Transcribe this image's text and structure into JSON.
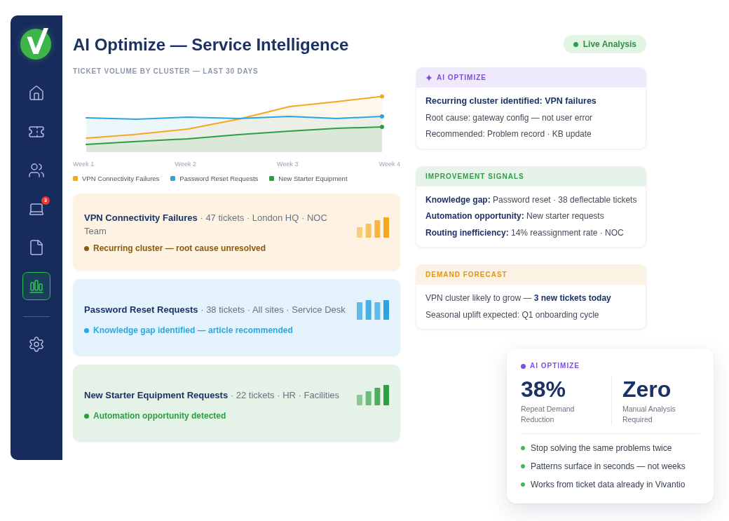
{
  "sidebar": {
    "nav_items": [
      {
        "selected": false
      },
      {
        "selected": false
      },
      {
        "selected": false
      },
      {
        "selected": false,
        "badge": "3"
      },
      {
        "selected": false
      },
      {
        "selected": true
      }
    ],
    "bottom_items": [
      {
        "selected": false
      }
    ]
  },
  "title": "AI Optimize — Service Intelligence",
  "status_pill": {
    "label": "Live Analysis"
  },
  "chart": {
    "title": "TICKET VOLUME BY CLUSTER — LAST 30 DAYS",
    "x_labels": [
      "Week 1",
      "Week 2",
      "Week 3",
      "Week 4"
    ],
    "legend": [
      {
        "label": "VPN Connectivity Failures",
        "color": "#f5a623"
      },
      {
        "label": "Password Reset Requests",
        "color": "#2ea3e0"
      },
      {
        "label": "New Starter Equipment",
        "color": "#2e9e44"
      }
    ]
  },
  "clusters": [
    {
      "kind": "rising",
      "summary": "**VPN Connectivity Failures** · 47 tickets · London HQ · NOC Team",
      "color": "#f5a623",
      "status": {
        "text": "Recurring cluster — root cause unresolved",
        "color": "#8b5a0c"
      }
    },
    {
      "kind": "steady",
      "summary": "**Password Reset Requests** · 38 tickets · All sites · Service Desk",
      "color": "#2ea3e0",
      "status": {
        "text": "Knowledge gap identified — article recommended",
        "color": "#2ea8e0"
      }
    },
    {
      "kind": "rising",
      "summary": "**New Starter Equipment Requests** · 22 tickets · HR · Facilities",
      "color": "#2e9e44",
      "status": {
        "text": "Automation opportunity detected",
        "color": "#2e9e44"
      }
    }
  ],
  "insight_panels": [
    {
      "kind": "ai",
      "title": "AI OPTIMIZE",
      "color": "#7c4ddb",
      "headline": "Recurring cluster identified: VPN failures",
      "lines": [
        "Root cause: gateway config — not user error",
        "Recommended: Problem record · KB update"
      ]
    },
    {
      "kind": "signals",
      "title": "IMPROVEMENT SIGNALS",
      "color": "#2e9e44",
      "lines": [
        "**Knowledge gap:** Password reset · 38 deflectable tickets",
        "**Automation opportunity:** New starter requests",
        "**Routing inefficiency:** 14% reassignment rate · NOC"
      ]
    },
    {
      "kind": "forecast",
      "title": "DEMAND FORECAST",
      "color": "#e0941a",
      "lines": [
        "VPN cluster likely to grow — **3 new tickets today**",
        "Seasonal uplift expected: Q1 onboarding cycle"
      ]
    }
  ],
  "summary_card": {
    "label": "AI OPTIMIZE",
    "stats": [
      {
        "value": "38%",
        "label": "Repeat Demand Reduction"
      },
      {
        "value": "Zero",
        "label": "Manual Analysis Required"
      }
    ],
    "benefits": [
      "Stop solving the same problems twice",
      "Patterns surface in seconds — not weeks",
      "Works from ticket data already in Vivantio"
    ]
  }
}
